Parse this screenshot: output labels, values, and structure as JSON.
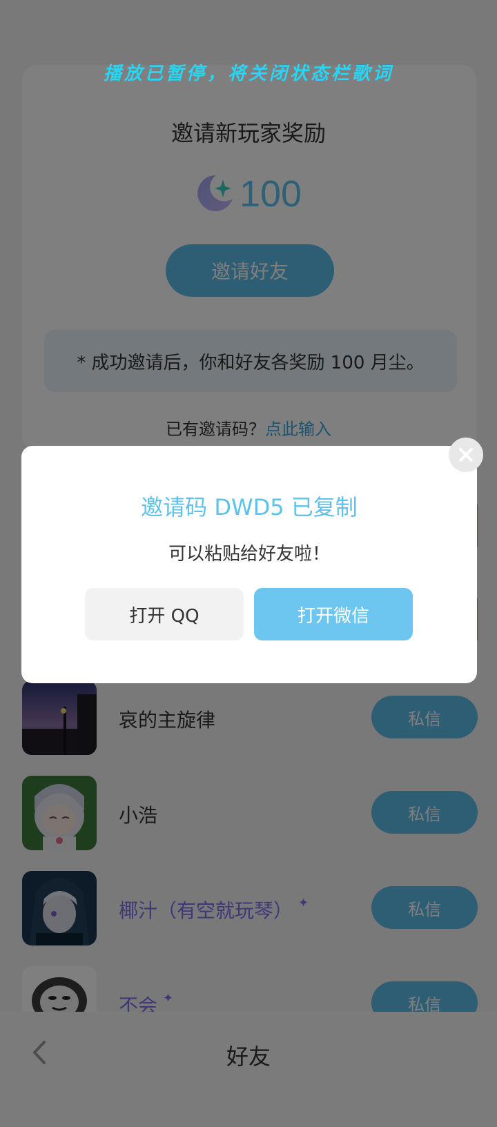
{
  "status_overlay": {
    "lyric_notice": "播放已暂停，将关闭状态栏歌词"
  },
  "invite": {
    "title": "邀请新玩家奖励",
    "reward_amount": "100",
    "reward_icon": "moon-sparkle-icon",
    "button_label": "邀请好友",
    "note": "* 成功邀请后，你和好友各奖励 100 月尘。",
    "have_code_prefix": "已有邀请码？",
    "have_code_link": "点此输入"
  },
  "friends": [
    {
      "name": "哀的主旋律",
      "vip": false,
      "dm_label": "私信",
      "avatar": "night-street-avatar"
    },
    {
      "name": "小浩",
      "vip": false,
      "dm_label": "私信",
      "avatar": "anime-girl-avatar"
    },
    {
      "name": "椰汁（有空就玩琴）",
      "vip": true,
      "dm_label": "私信",
      "avatar": "hooded-anime-avatar"
    },
    {
      "name": "不会",
      "vip": true,
      "dm_label": "私信",
      "avatar": "panda-meme-avatar"
    }
  ],
  "bottom_nav": {
    "title": "好友"
  },
  "dialog": {
    "title": "邀请码 DWD5 已复制",
    "subtitle": "可以粘贴给好友啦！",
    "btn_qq": "打开 QQ",
    "btn_wechat": "打开微信"
  },
  "colors": {
    "accent": "#5cbde8",
    "vip_name": "#7a6ef0",
    "lyric": "#2ad4f4"
  }
}
